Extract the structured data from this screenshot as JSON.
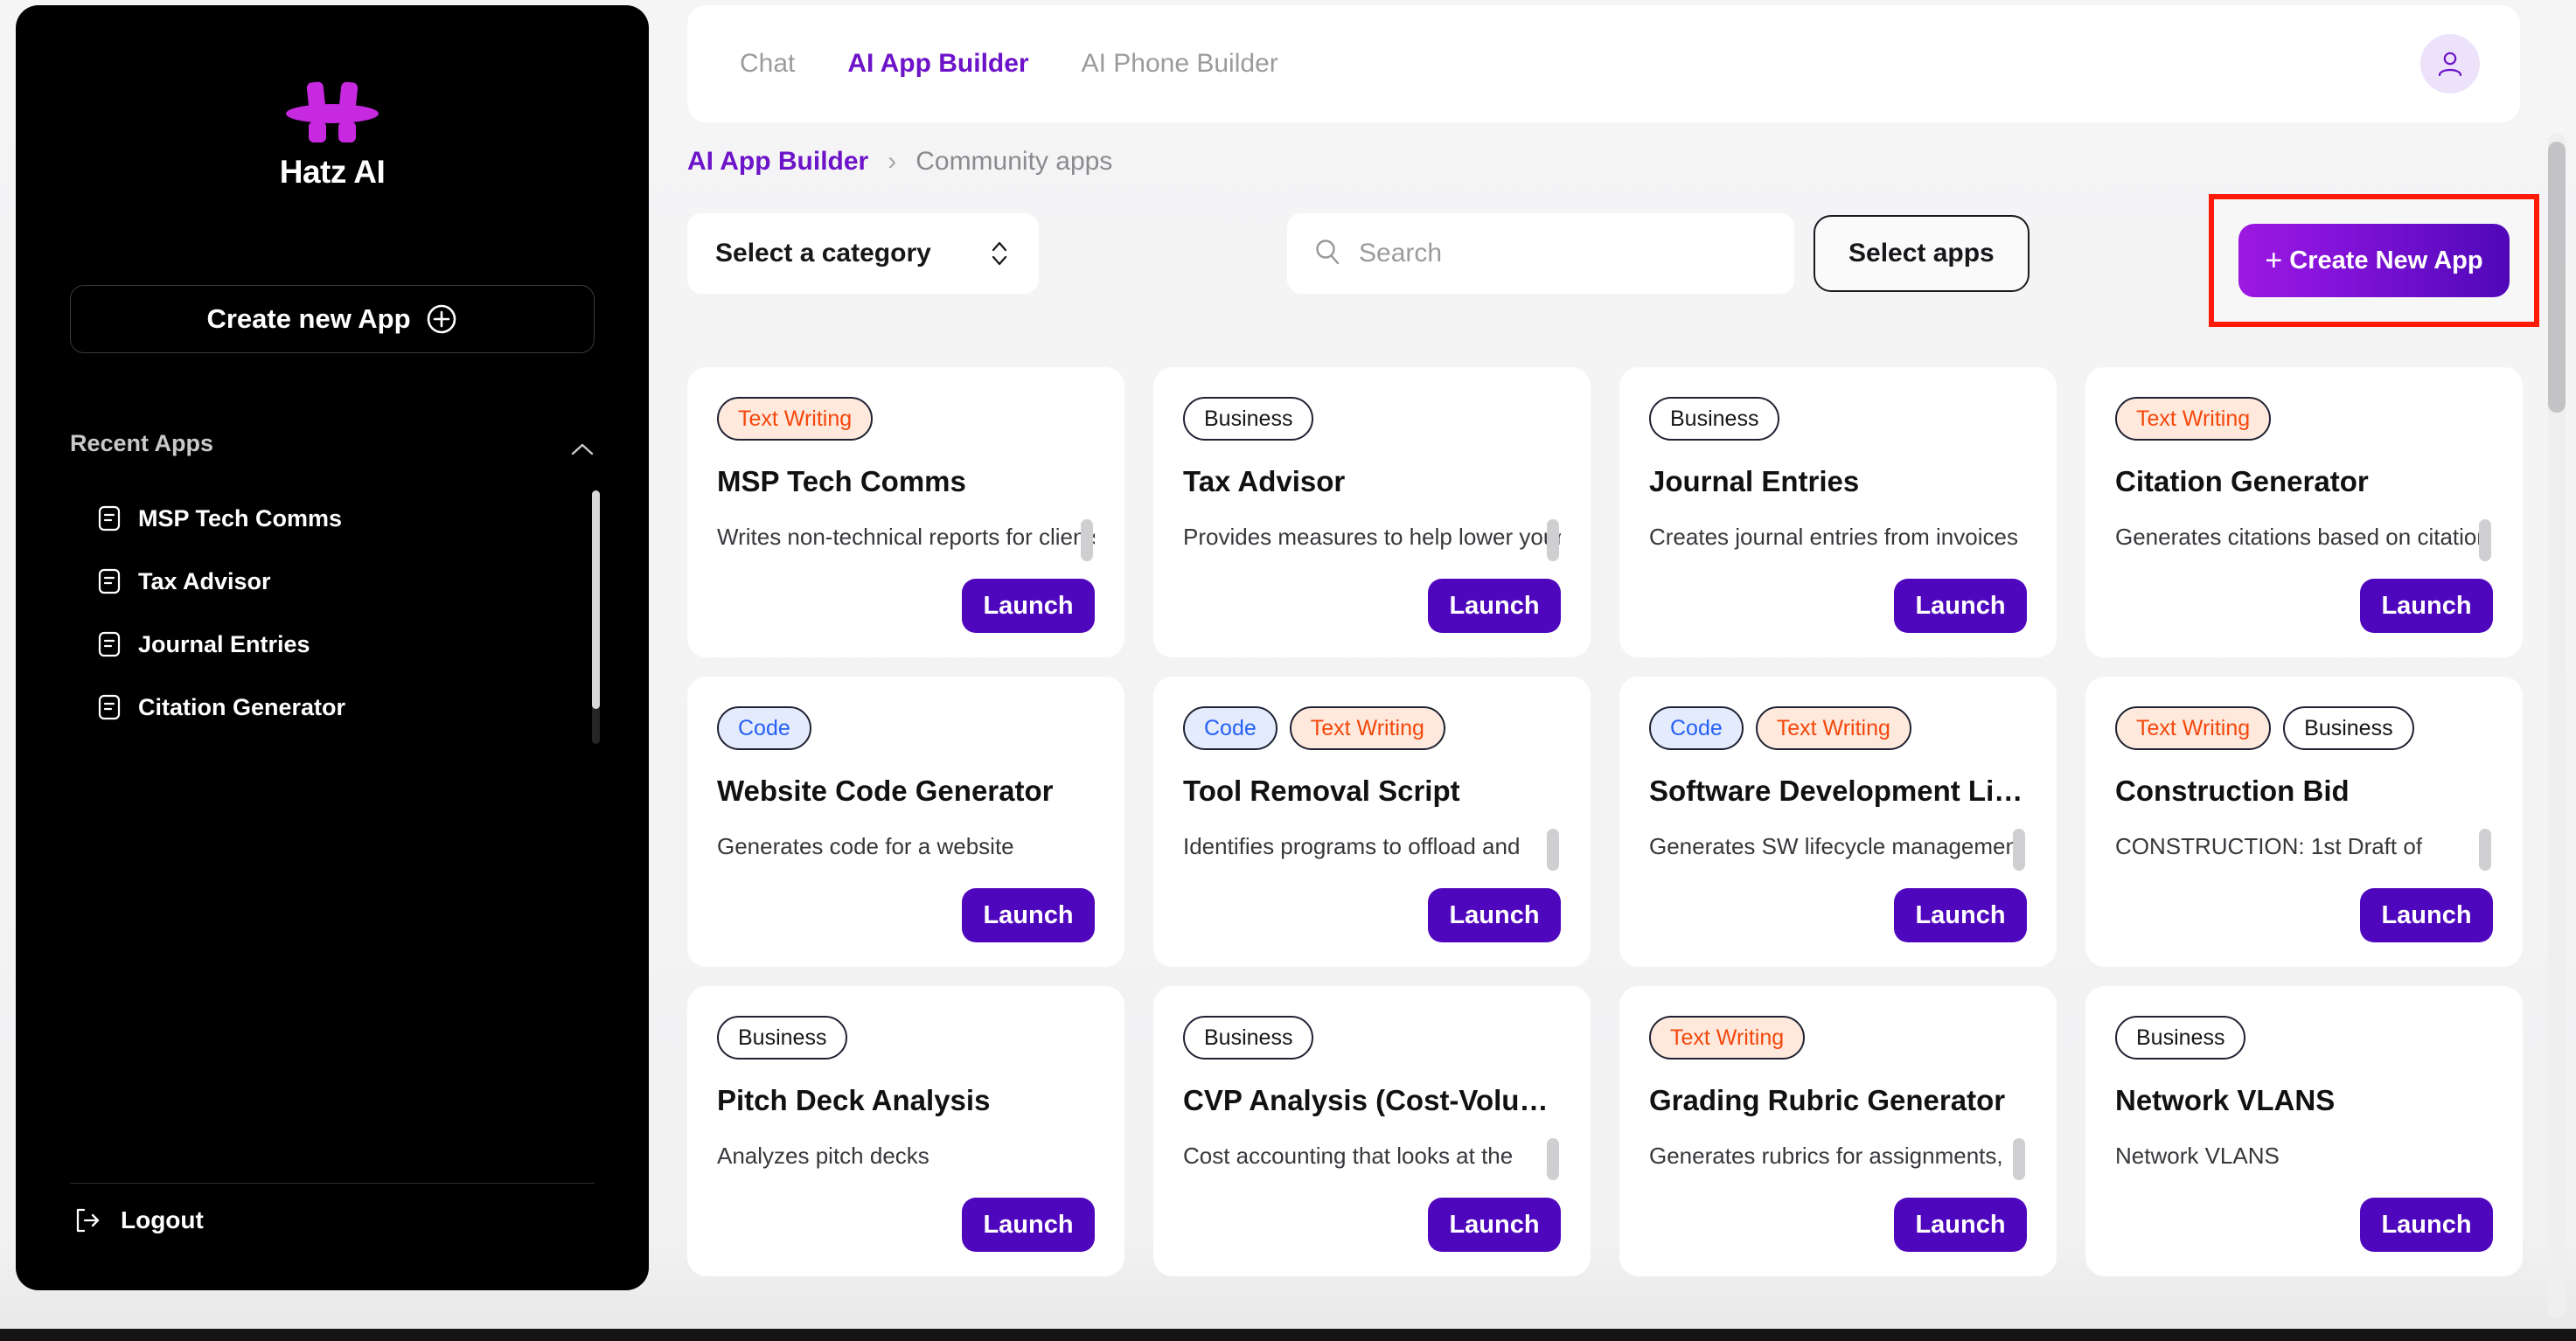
{
  "sidebar": {
    "brand_name": "Hatz AI",
    "logo_icon": "hatz-logo",
    "create_app_label": "Create new App",
    "create_app_icon": "plus-circle-icon",
    "recent_header": "Recent Apps",
    "recent_collapse_icon": "chevron-up-icon",
    "recent_items": [
      {
        "label": "MSP Tech Comms",
        "icon": "document-icon"
      },
      {
        "label": "Tax Advisor",
        "icon": "document-icon"
      },
      {
        "label": "Journal Entries",
        "icon": "document-icon"
      },
      {
        "label": "Citation Generator",
        "icon": "document-icon"
      }
    ],
    "logout_label": "Logout",
    "logout_icon": "logout-icon"
  },
  "topbar": {
    "tabs": [
      {
        "label": "Chat",
        "active": false
      },
      {
        "label": "AI App Builder",
        "active": true
      },
      {
        "label": "AI Phone Builder",
        "active": false
      }
    ],
    "avatar_icon": "user-avatar-icon"
  },
  "breadcrumb": {
    "parent": "AI App Builder",
    "separator": "›",
    "current": "Community apps"
  },
  "filters": {
    "category_label": "Select a category",
    "category_icon": "chevron-updown-icon",
    "search_placeholder": "Search",
    "search_value": "",
    "search_icon": "search-icon",
    "select_apps_label": "Select apps",
    "create_new_label": "Create New App",
    "create_new_plus": "+",
    "highlight_color": "#ff1a05"
  },
  "colors": {
    "brand_purple": "#6d13c9",
    "launch_purple": "#4f07bd",
    "tag_text_writing": "#f4470b",
    "tag_code": "#2660f5",
    "tag_business": "#16161a",
    "sidebar_bg": "#000000"
  },
  "cards": [
    {
      "tags": [
        {
          "label": "Text Writing",
          "style": "text-writing"
        }
      ],
      "title": "MSP Tech Comms",
      "desc": "Writes non-technical reports for clients",
      "launch_label": "Launch",
      "has_desc_scroll": true
    },
    {
      "tags": [
        {
          "label": "Business",
          "style": "business"
        }
      ],
      "title": "Tax Advisor",
      "desc": "Provides measures to help lower your",
      "launch_label": "Launch",
      "has_desc_scroll": true
    },
    {
      "tags": [
        {
          "label": "Business",
          "style": "business"
        }
      ],
      "title": "Journal Entries",
      "desc": "Creates journal entries from invoices",
      "launch_label": "Launch",
      "has_desc_scroll": false
    },
    {
      "tags": [
        {
          "label": "Text Writing",
          "style": "text-writing"
        }
      ],
      "title": "Citation Generator",
      "desc": "Generates citations based on citation",
      "launch_label": "Launch",
      "has_desc_scroll": true
    },
    {
      "tags": [
        {
          "label": "Code",
          "style": "code"
        }
      ],
      "title": "Website Code Generator",
      "desc": "Generates code for a website",
      "launch_label": "Launch",
      "has_desc_scroll": false
    },
    {
      "tags": [
        {
          "label": "Code",
          "style": "code"
        },
        {
          "label": "Text Writing",
          "style": "text-writing"
        }
      ],
      "title": "Tool Removal Script",
      "desc": "Identifies programs to offload and",
      "launch_label": "Launch",
      "has_desc_scroll": true
    },
    {
      "tags": [
        {
          "label": "Code",
          "style": "code"
        },
        {
          "label": "Text Writing",
          "style": "text-writing"
        }
      ],
      "title": "Software Development Lifec...",
      "desc": "Generates SW lifecycle management",
      "launch_label": "Launch",
      "has_desc_scroll": true
    },
    {
      "tags": [
        {
          "label": "Text Writing",
          "style": "text-writing"
        },
        {
          "label": "Business",
          "style": "business"
        }
      ],
      "title": "Construction Bid",
      "desc": "CONSTRUCTION: 1st Draft of",
      "launch_label": "Launch",
      "has_desc_scroll": true
    },
    {
      "tags": [
        {
          "label": "Business",
          "style": "business"
        }
      ],
      "title": "Pitch Deck Analysis",
      "desc": "Analyzes pitch decks",
      "launch_label": "Launch",
      "has_desc_scroll": false
    },
    {
      "tags": [
        {
          "label": "Business",
          "style": "business"
        }
      ],
      "title": "CVP Analysis (Cost-Volume-...",
      "desc": "Cost accounting that looks at the",
      "launch_label": "Launch",
      "has_desc_scroll": true
    },
    {
      "tags": [
        {
          "label": "Text Writing",
          "style": "text-writing"
        }
      ],
      "title": "Grading Rubric Generator",
      "desc": "Generates rubrics for assignments,",
      "launch_label": "Launch",
      "has_desc_scroll": true
    },
    {
      "tags": [
        {
          "label": "Business",
          "style": "business"
        }
      ],
      "title": "Network VLANS",
      "desc": "Network VLANS",
      "launch_label": "Launch",
      "has_desc_scroll": false
    }
  ]
}
